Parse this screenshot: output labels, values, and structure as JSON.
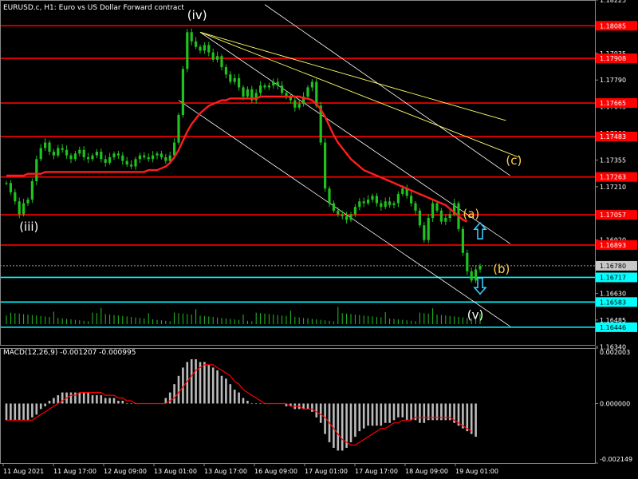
{
  "header": {
    "symbol_title": "EURUSD.c, H1:  Euro vs US Dollar Forward contract",
    "macd_title": "MACD(12,26,9) -0.001207 -0.000995"
  },
  "colors": {
    "background": "#000000",
    "candle": "#1fc21f",
    "red_level": "#ff0000",
    "red_badge": "#ff0000",
    "cyan_level": "#00ffff",
    "cyan_badge": "#00ffff",
    "channel": "#ffffff",
    "trendline": "#ffff66",
    "ma": "#ff1e1e",
    "macd_hist": "#bbbbbb",
    "macd_signal": "#ff0000",
    "wave_white": "#ffffff",
    "wave_yellow": "#ffd24a",
    "arrow_cyan": "#39c8ff",
    "axis_text": "#ffffff"
  },
  "price_axis": {
    "min": 1.1635,
    "max": 1.18225,
    "ticks": [
      "1.18225",
      "1.18080",
      "1.17935",
      "1.17790",
      "1.17645",
      "1.17500",
      "1.17355",
      "1.17210",
      "1.17065",
      "1.16920",
      "1.16780",
      "1.16630",
      "1.16485",
      "1.16340"
    ]
  },
  "time_axis": {
    "labels": [
      "11 Aug 2021",
      "11 Aug 17:00",
      "12 Aug 09:00",
      "13 Aug 01:00",
      "13 Aug 17:00",
      "16 Aug 09:00",
      "17 Aug 01:00",
      "17 Aug 17:00",
      "18 Aug 09:00",
      "19 Aug 01:00"
    ]
  },
  "macd_axis": {
    "min": -0.002149,
    "max": 0.002003,
    "ticks": [
      "0.002003",
      "0.000000",
      "-0.002149"
    ]
  },
  "levels": [
    {
      "price": 1.18085,
      "label": "1.18085",
      "kind": "red"
    },
    {
      "price": 1.17908,
      "label": "1.17908",
      "kind": "red"
    },
    {
      "price": 1.17665,
      "label": "1.17665",
      "kind": "red"
    },
    {
      "price": 1.17483,
      "label": "1.17483",
      "kind": "red"
    },
    {
      "price": 1.17263,
      "label": "1.17263",
      "kind": "red"
    },
    {
      "price": 1.17057,
      "label": "1.17057",
      "kind": "red"
    },
    {
      "price": 1.16893,
      "label": "1.16893",
      "kind": "red"
    },
    {
      "price": 1.16717,
      "label": "1.16717",
      "kind": "cyan"
    },
    {
      "price": 1.16583,
      "label": "1.16583",
      "kind": "cyan"
    },
    {
      "price": 1.16446,
      "label": "1.16446",
      "kind": "cyan"
    }
  ],
  "current_price": {
    "price": 1.1678,
    "label": "1.16780"
  },
  "wave_labels": [
    {
      "text": "(iv)",
      "bar": 42,
      "price": 1.1812,
      "color": "white"
    },
    {
      "text": "(iii)",
      "bar": 3,
      "price": 1.1697,
      "color": "white"
    },
    {
      "text": "(c)",
      "bar": 116,
      "price": 1.1733,
      "color": "yellow"
    },
    {
      "text": "(a)",
      "bar": 106,
      "price": 1.1704,
      "color": "yellow"
    },
    {
      "text": "(b)",
      "bar": 113,
      "price": 1.1674,
      "color": "yellow"
    },
    {
      "text": "(v)",
      "bar": 107,
      "price": 1.1649,
      "color": "white"
    }
  ],
  "arrows": [
    {
      "dir": "up",
      "bar": 110,
      "price": 1.1697
    },
    {
      "dir": "down",
      "bar": 110,
      "price": 1.1667
    }
  ],
  "chart_data": {
    "type": "line",
    "title": "EURUSD.c, H1:  Euro vs US Dollar Forward contract",
    "subtitle": "MACD(12,26,9) -0.001207 -0.000995",
    "xlabel": "",
    "ylabel": "",
    "x": [
      "11 Aug 2021",
      "11 Aug 17:00",
      "12 Aug 09:00",
      "13 Aug 01:00",
      "13 Aug 17:00",
      "16 Aug 09:00",
      "17 Aug 01:00",
      "17 Aug 17:00",
      "18 Aug 09:00",
      "19 Aug 01:00"
    ],
    "ylim": [
      1.1635,
      1.18225
    ],
    "series": [
      {
        "values": [
          1.1723,
          1.1718,
          1.1713,
          1.1706,
          1.1712,
          1.1714,
          1.1724,
          1.1736,
          1.1742,
          1.1745,
          1.174,
          1.1738,
          1.1742,
          1.1741,
          1.1738,
          1.1736,
          1.1739,
          1.1741,
          1.1737,
          1.1736,
          1.1738,
          1.174,
          1.1736,
          1.1734,
          1.1737,
          1.1739,
          1.1738,
          1.1735,
          1.1733,
          1.1732,
          1.1736,
          1.1738,
          1.1737,
          1.1736,
          1.1738,
          1.1739,
          1.1737,
          1.1735,
          1.1738,
          1.1745,
          1.176,
          1.1785,
          1.1805,
          1.18,
          1.1797,
          1.1795,
          1.1798,
          1.1794,
          1.179,
          1.1792,
          1.1786,
          1.1782,
          1.1778,
          1.178,
          1.1775,
          1.177,
          1.1774,
          1.1768,
          1.1772,
          1.1776,
          1.1775,
          1.1776,
          1.1778,
          1.1776,
          1.1772,
          1.177,
          1.1768,
          1.1764,
          1.1766,
          1.177,
          1.1775,
          1.1778,
          1.1765,
          1.1745,
          1.172,
          1.1712,
          1.1708,
          1.1706,
          1.1705,
          1.1703,
          1.1706,
          1.171,
          1.1713,
          1.1712,
          1.1714,
          1.1716,
          1.1712,
          1.171,
          1.1713,
          1.1711,
          1.1712,
          1.1717,
          1.172,
          1.1716,
          1.1712,
          1.1708,
          1.17,
          1.1692,
          1.1704,
          1.1712,
          1.1708,
          1.1702,
          1.1704,
          1.1706,
          1.1712,
          1.1698,
          1.1685,
          1.1675,
          1.167,
          1.1676,
          1.1678
        ]
      }
    ],
    "moving_average": [
      1.1727,
      1.1727,
      1.1727,
      1.1727,
      1.1727,
      1.1728,
      1.1728,
      1.1728,
      1.1728,
      1.1729,
      1.1729,
      1.1729,
      1.1729,
      1.1729,
      1.1729,
      1.1729,
      1.1729,
      1.1729,
      1.1729,
      1.1729,
      1.1729,
      1.1729,
      1.1729,
      1.1729,
      1.1729,
      1.1729,
      1.1729,
      1.1729,
      1.1729,
      1.1729,
      1.1729,
      1.1729,
      1.1729,
      1.173,
      1.173,
      1.173,
      1.1731,
      1.1732,
      1.1734,
      1.1737,
      1.1741,
      1.1746,
      1.1751,
      1.1755,
      1.1758,
      1.1761,
      1.1763,
      1.1765,
      1.1766,
      1.1767,
      1.1768,
      1.1768,
      1.1769,
      1.1769,
      1.1769,
      1.1769,
      1.1769,
      1.1769,
      1.1769,
      1.177,
      1.177,
      1.177,
      1.177,
      1.177,
      1.177,
      1.177,
      1.177,
      1.177,
      1.177,
      1.1769,
      1.1769,
      1.1768,
      1.1766,
      1.1763,
      1.1759,
      1.1754,
      1.1749,
      1.1745,
      1.1742,
      1.1739,
      1.1736,
      1.1734,
      1.1732,
      1.173,
      1.1729,
      1.1728,
      1.1727,
      1.1726,
      1.1725,
      1.1724,
      1.1723,
      1.1722,
      1.1721,
      1.172,
      1.1719,
      1.1718,
      1.1717,
      1.1716,
      1.1715,
      1.1714,
      1.1713,
      1.1712,
      1.1711,
      1.1709,
      1.1707,
      1.1705,
      1.1703,
      1.1702
    ],
    "macd_histogram": [
      -0.0006,
      -0.0006,
      -0.0006,
      -0.0006,
      -0.0006,
      -0.0006,
      -0.0005,
      -0.0004,
      -0.0002,
      -0.0001,
      0.0001,
      0.0002,
      0.0003,
      0.0004,
      0.0004,
      0.0004,
      0.0004,
      0.0004,
      0.0004,
      0.0004,
      0.0003,
      0.0003,
      0.0003,
      0.0002,
      0.0002,
      0.0002,
      0.0001,
      0.0001,
      0.0,
      0.0,
      0.0,
      0.0,
      0.0,
      0.0,
      0.0,
      0.0,
      0.0,
      0.0002,
      0.0004,
      0.0007,
      0.001,
      0.0013,
      0.0015,
      0.0016,
      0.0016,
      0.0015,
      0.0015,
      0.0014,
      0.0013,
      0.0012,
      0.001,
      0.0009,
      0.0007,
      0.0005,
      0.0004,
      0.0002,
      0.0001,
      0.0,
      0.0,
      0.0,
      0.0,
      0.0,
      0.0,
      0.0,
      0.0,
      -0.0001,
      -0.0001,
      -0.0002,
      -0.0002,
      -0.0002,
      -0.0002,
      -0.0003,
      -0.0005,
      -0.0007,
      -0.0011,
      -0.0014,
      -0.0016,
      -0.0017,
      -0.0017,
      -0.0016,
      -0.0014,
      -0.0012,
      -0.001,
      -0.0009,
      -0.0008,
      -0.0008,
      -0.0008,
      -0.0008,
      -0.0007,
      -0.0007,
      -0.0006,
      -0.0005,
      -0.0005,
      -0.0006,
      -0.0006,
      -0.0006,
      -0.0007,
      -0.0007,
      -0.0006,
      -0.0006,
      -0.0006,
      -0.0006,
      -0.0006,
      -0.0006,
      -0.0007,
      -0.0008,
      -0.0009,
      -0.001,
      -0.0011,
      -0.0012
    ],
    "macd_signal": [
      -0.0006,
      -0.0006,
      -0.0006,
      -0.0006,
      -0.0006,
      -0.0006,
      -0.0006,
      -0.0005,
      -0.0004,
      -0.0003,
      -0.0002,
      -0.0001,
      0.0,
      0.0001,
      0.0002,
      0.0003,
      0.0003,
      0.0004,
      0.0004,
      0.0004,
      0.0004,
      0.0004,
      0.0004,
      0.0003,
      0.0003,
      0.0003,
      0.0002,
      0.0002,
      0.0001,
      0.0001,
      0.0,
      0.0,
      0.0,
      0.0,
      0.0,
      0.0,
      0.0,
      0.0,
      0.0001,
      0.0002,
      0.0004,
      0.0006,
      0.0008,
      0.001,
      0.0012,
      0.0013,
      0.0014,
      0.0014,
      0.0014,
      0.0013,
      0.0012,
      0.0011,
      0.001,
      0.0008,
      0.0007,
      0.0005,
      0.0004,
      0.0003,
      0.0002,
      0.0001,
      0.0,
      0.0,
      0.0,
      0.0,
      0.0,
      0.0,
      -0.0001,
      -0.0001,
      -0.0001,
      -0.0002,
      -0.0002,
      -0.0002,
      -0.0003,
      -0.0004,
      -0.0005,
      -0.0007,
      -0.0009,
      -0.0011,
      -0.0013,
      -0.0014,
      -0.0015,
      -0.0015,
      -0.0014,
      -0.0013,
      -0.0012,
      -0.0011,
      -0.001,
      -0.0009,
      -0.0009,
      -0.0008,
      -0.0007,
      -0.0007,
      -0.0006,
      -0.0006,
      -0.0006,
      -0.0005,
      -0.0005,
      -0.0005,
      -0.0005,
      -0.0005,
      -0.0005,
      -0.0005,
      -0.0005,
      -0.0005,
      -0.0006,
      -0.0007,
      -0.0008,
      -0.0009,
      -0.001
    ],
    "grid": false,
    "legend": "none"
  }
}
